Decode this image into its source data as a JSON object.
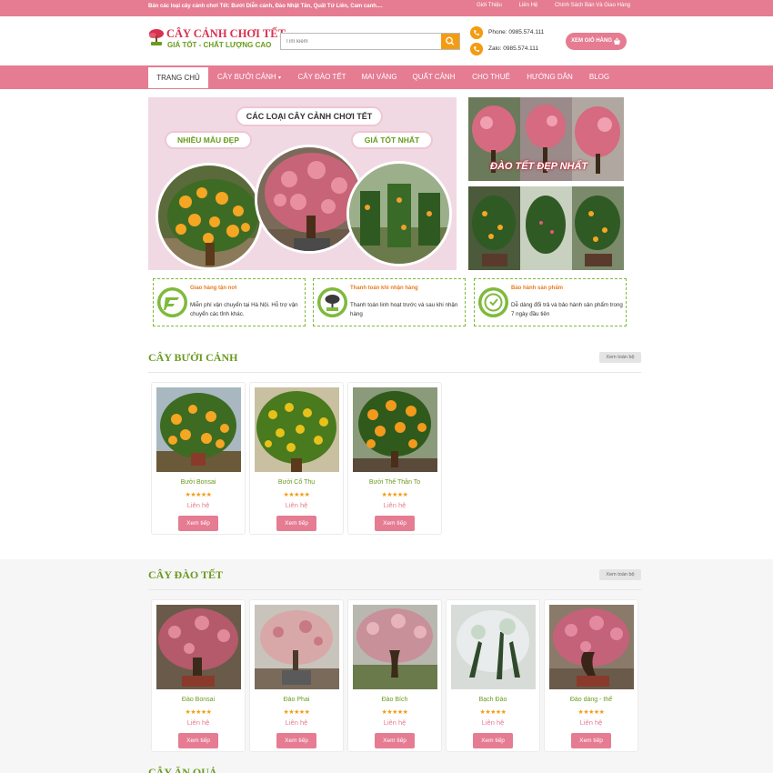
{
  "topbar": {
    "tagline": "Bán các loại cây cảnh chơi Tết: Bưởi Diễn cảnh, Đào Nhật Tân, Quất Tứ Liên, Cam canh....",
    "links": [
      "Giới Thiệu",
      "Liên Hệ",
      "Chính Sách Bán Và Giao Hàng"
    ]
  },
  "header": {
    "logo_name": "CÂY CẢNH CHƠI TẾT",
    "logo_slogan": "GIÁ TỐT - CHẤT LƯỢNG CAO",
    "search_placeholder": "Tìm kiếm",
    "phone": "Phone: 0985.574.111",
    "zalo": "Zalo: 0985.574.111",
    "cart_label": "XEM GIỎ HÀNG"
  },
  "nav": {
    "items": [
      "TRANG CHỦ",
      "CÂY BƯỞI CẢNH",
      "CÂY ĐÀO TẾT",
      "MAI VÀNG",
      "QUẤT CẢNH",
      "CHO THUÊ",
      "HƯỚNG DẪN",
      "BLOG"
    ],
    "active": "TRANG CHỦ",
    "dropdown_arrow": "▾"
  },
  "banner": {
    "headline": "CÁC LOẠI CÂY CẢNH CHƠI TẾT",
    "pill_left": "NHIỀU MẪU ĐẸP",
    "pill_right": "GIÁ TỐT NHẤT",
    "side_caption": "ĐÀO TẾT ĐẸP NHẤT"
  },
  "features": [
    {
      "title": "Giao hàng tận nơi",
      "desc": "Miễn phí vận chuyển tại Hà Nội. Hỗ trợ vận chuyển các tỉnh khác."
    },
    {
      "title": "Thanh toán khi nhận hàng",
      "desc": "Thanh toán linh hoạt trước và sau khi nhận hàng"
    },
    {
      "title": "Bảo hành sản phẩm",
      "desc": "Dễ dàng đổi trả và bảo hành sản phẩm trong 7 ngày đầu tiên"
    }
  ],
  "sections": {
    "buoi": {
      "title": "CÂY BƯỞI CẢNH",
      "view_all": "Xem toàn bộ",
      "products": [
        {
          "name": "Bưởi Bonsai",
          "stars": "★★★★★",
          "price": "Liên hệ",
          "button": "Xem tiếp"
        },
        {
          "name": "Bưởi Cổ Thụ",
          "stars": "★★★★★",
          "price": "Liên hệ",
          "button": "Xem tiếp"
        },
        {
          "name": "Bưởi Thế Thần To",
          "stars": "★★★★★",
          "price": "Liên hệ",
          "button": "Xem tiếp"
        }
      ]
    },
    "dao": {
      "title": "CÂY ĐÀO TẾT",
      "view_all": "Xem toàn bộ",
      "products": [
        {
          "name": "Đào Bonsai",
          "stars": "★★★★★",
          "price": "Liên hệ",
          "button": "Xem tiếp"
        },
        {
          "name": "Đào Phai",
          "stars": "★★★★★",
          "price": "Liên hệ",
          "button": "Xem tiếp"
        },
        {
          "name": "Đào Bích",
          "stars": "★★★★★",
          "price": "Liên hệ",
          "button": "Xem tiếp"
        },
        {
          "name": "Bạch Đào",
          "stars": "★★★★★",
          "price": "Liên hệ",
          "button": "Xem tiếp"
        },
        {
          "name": "Đào dáng - thế",
          "stars": "★★★★★",
          "price": "Liên hệ",
          "button": "Xem tiếp"
        }
      ]
    },
    "next_title": "CÂY ĂN QUẢ"
  },
  "colors": {
    "brand_pink": "#e57c92",
    "brand_green": "#6a9a1f",
    "accent_orange": "#f39c12",
    "logo_red": "#d9304f"
  }
}
